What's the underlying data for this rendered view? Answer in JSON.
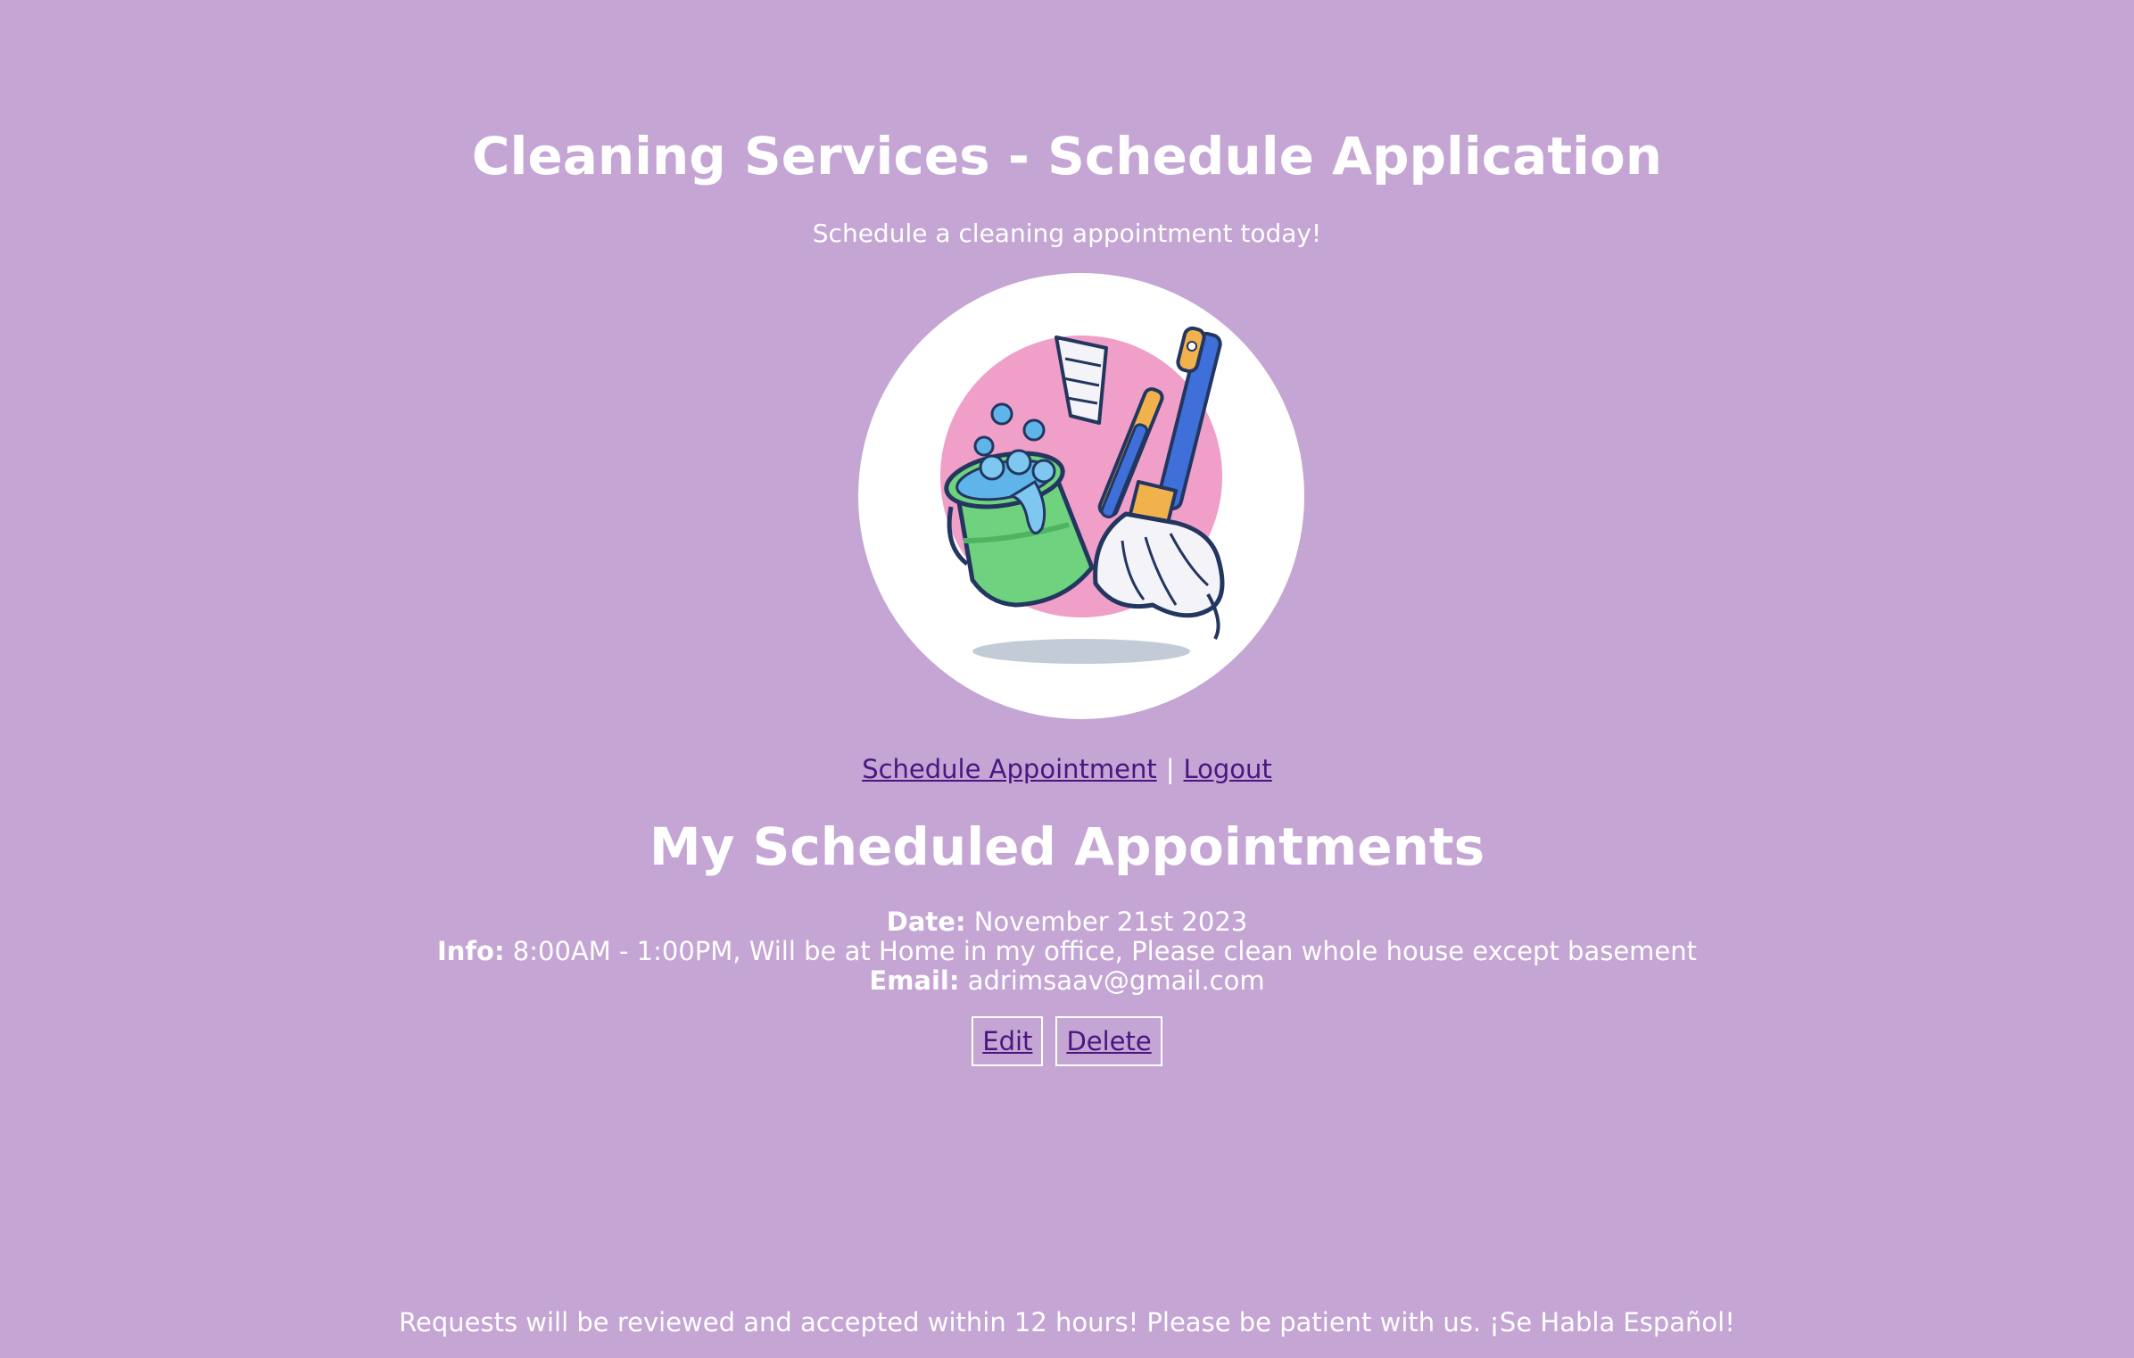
{
  "header": {
    "title": "Cleaning Services - Schedule Application",
    "subtitle": "Schedule a cleaning appointment today!"
  },
  "logo": {
    "icon": "bucket-and-mop-icon"
  },
  "nav": {
    "schedule_label": "Schedule Appointment",
    "separator": "|",
    "logout_label": "Logout"
  },
  "appointments": {
    "heading": "My Scheduled Appointments",
    "items": [
      {
        "date_label": "Date:",
        "date": "November 21st 2023",
        "info_label": "Info:",
        "info": "8:00AM - 1:00PM, Will be at Home in my office, Please clean whole house except basement",
        "email_label": "Email:",
        "email": "adrimsaav@gmail.com",
        "edit_label": "Edit",
        "delete_label": "Delete"
      }
    ]
  },
  "footer": {
    "text": "Requests will be reviewed and accepted within 12 hours! Please be patient with us. ¡Se Habla Español!"
  },
  "colors": {
    "background": "#c4a5d4",
    "text": "#ffffff",
    "link": "#4a1580"
  }
}
